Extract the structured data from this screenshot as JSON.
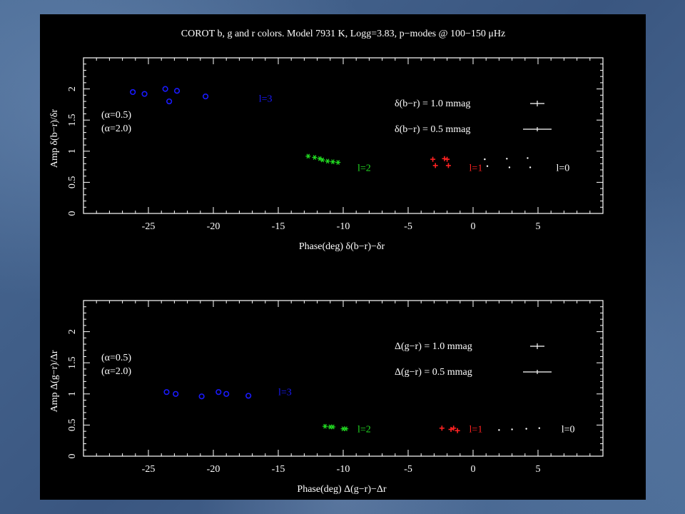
{
  "title": "COROT b, g and r colors. Model 7931 K, Logg=3.83, p−modes @ 100−150 μHz",
  "colors": {
    "l3": "#1a1aff",
    "l2": "#22dd22",
    "l1": "#ff2222",
    "l0": "#ffffff"
  },
  "chart_data": [
    {
      "type": "scatter",
      "xlabel": "Phase(deg) δ(b−r)−δr",
      "ylabel": "Amp δ(b−r)/δr",
      "xlim": [
        -30,
        10
      ],
      "ylim": [
        0,
        2.5
      ],
      "xticks": [
        "-25",
        "-20",
        "-15",
        "-10",
        "-5",
        "0",
        "5"
      ],
      "yticks": [
        "0",
        "0.5",
        "1",
        "1.5",
        "2"
      ],
      "annotations": [
        "(α=0.5)",
        "(α=2.0)"
      ],
      "error_legend": [
        "δ(b−r) = 1.0 mmag",
        "δ(b−r) = 0.5 mmag"
      ],
      "series": [
        {
          "name": "l=3",
          "marker": "circle",
          "points": [
            [
              -26.2,
              1.95
            ],
            [
              -25.3,
              1.92
            ],
            [
              -23.7,
              2.0
            ],
            [
              -23.4,
              1.8
            ],
            [
              -22.8,
              1.97
            ],
            [
              -20.6,
              1.88
            ]
          ]
        },
        {
          "name": "l=2",
          "marker": "star",
          "points": [
            [
              -12.7,
              0.92
            ],
            [
              -12.2,
              0.9
            ],
            [
              -11.8,
              0.88
            ],
            [
              -11.6,
              0.86
            ],
            [
              -11.2,
              0.84
            ],
            [
              -10.8,
              0.83
            ],
            [
              -10.4,
              0.82
            ]
          ]
        },
        {
          "name": "l=1",
          "marker": "plus",
          "points": [
            [
              -3.1,
              0.87
            ],
            [
              -2.9,
              0.77
            ],
            [
              -2.2,
              0.88
            ],
            [
              -2.0,
              0.87
            ],
            [
              -1.9,
              0.77
            ]
          ]
        },
        {
          "name": "l=0",
          "marker": "dot",
          "points": [
            [
              0.9,
              0.87
            ],
            [
              1.1,
              0.76
            ],
            [
              2.6,
              0.88
            ],
            [
              2.8,
              0.74
            ],
            [
              4.2,
              0.89
            ],
            [
              4.4,
              0.74
            ]
          ]
        }
      ]
    },
    {
      "type": "scatter",
      "xlabel": "Phase(deg) Δ(g−r)−Δr",
      "ylabel": "Amp Δ(g−r)/Δr",
      "xlim": [
        -30,
        10
      ],
      "ylim": [
        0,
        2.5
      ],
      "xticks": [
        "-25",
        "-20",
        "-15",
        "-10",
        "-5",
        "0",
        "5"
      ],
      "yticks": [
        "0",
        "0.5",
        "1",
        "1.5",
        "2"
      ],
      "annotations": [
        "(α=0.5)",
        "(α=2.0)"
      ],
      "error_legend": [
        "Δ(g−r) = 1.0 mmag",
        "Δ(g−r) = 0.5 mmag"
      ],
      "series": [
        {
          "name": "l=3",
          "marker": "circle",
          "points": [
            [
              -23.6,
              1.03
            ],
            [
              -22.9,
              1.0
            ],
            [
              -20.9,
              0.96
            ],
            [
              -19.6,
              1.03
            ],
            [
              -19.0,
              1.0
            ],
            [
              -17.3,
              0.97
            ]
          ]
        },
        {
          "name": "l=2",
          "marker": "star",
          "points": [
            [
              -11.4,
              0.48
            ],
            [
              -11.0,
              0.47
            ],
            [
              -10.8,
              0.47
            ],
            [
              -10.0,
              0.44
            ],
            [
              -9.8,
              0.44
            ]
          ]
        },
        {
          "name": "l=1",
          "marker": "plus",
          "points": [
            [
              -2.4,
              0.45
            ],
            [
              -1.7,
              0.43
            ],
            [
              -1.5,
              0.45
            ],
            [
              -1.2,
              0.41
            ]
          ]
        },
        {
          "name": "l=0",
          "marker": "dot",
          "points": [
            [
              2.0,
              0.42
            ],
            [
              3.0,
              0.43
            ],
            [
              4.1,
              0.44
            ],
            [
              5.1,
              0.45
            ]
          ]
        }
      ]
    }
  ]
}
